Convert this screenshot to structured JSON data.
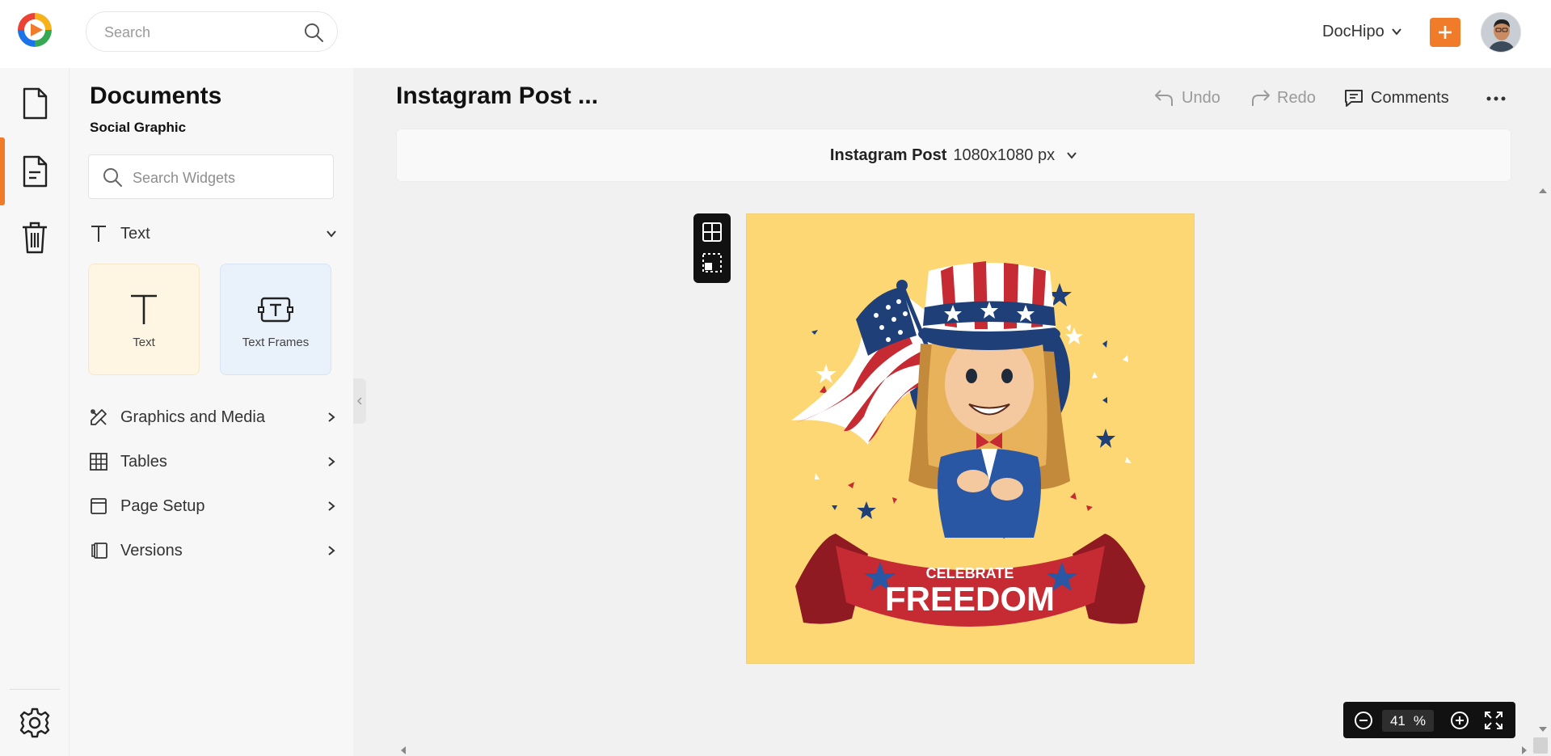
{
  "app": {
    "brand_colors": {
      "accent": "#f07c2a",
      "artboard": "#fdd773",
      "dark": "#111111"
    }
  },
  "topbar": {
    "search_placeholder": "Search",
    "account_label": "DocHipo",
    "icons": [
      "dochipo-logo-icon",
      "search-icon",
      "chevron-down-icon",
      "plus-icon",
      "avatar"
    ]
  },
  "rail": {
    "items": [
      {
        "name": "documents",
        "icon": "document-icon",
        "active": false
      },
      {
        "name": "widgets",
        "icon": "document-lines-icon",
        "active": true
      },
      {
        "name": "trash",
        "icon": "trash-icon",
        "active": false
      },
      {
        "name": "settings",
        "icon": "gear-icon",
        "active": false
      }
    ]
  },
  "panel": {
    "title": "Documents",
    "subtitle": "Social Graphic",
    "search_placeholder": "Search Widgets",
    "text_section": {
      "label": "Text",
      "expanded": true,
      "cards": [
        {
          "label": "Text",
          "icon": "text-t-icon"
        },
        {
          "label": "Text Frames",
          "icon": "text-frame-icon"
        }
      ]
    },
    "sections": [
      {
        "label": "Graphics and Media",
        "icon": "graphics-media-icon"
      },
      {
        "label": "Tables",
        "icon": "table-icon"
      },
      {
        "label": "Page Setup",
        "icon": "page-setup-icon"
      },
      {
        "label": "Versions",
        "icon": "versions-icon"
      }
    ]
  },
  "editor": {
    "doc_title": "Instagram Post ...",
    "undo_label": "Undo",
    "redo_label": "Redo",
    "comments_label": "Comments",
    "size_name": "Instagram Post",
    "size_dims": "1080x1080 px"
  },
  "artwork": {
    "banner_small": "CELEBRATE",
    "banner_large": "FREEDOM"
  },
  "zoom": {
    "value": "41",
    "unit": "%"
  }
}
